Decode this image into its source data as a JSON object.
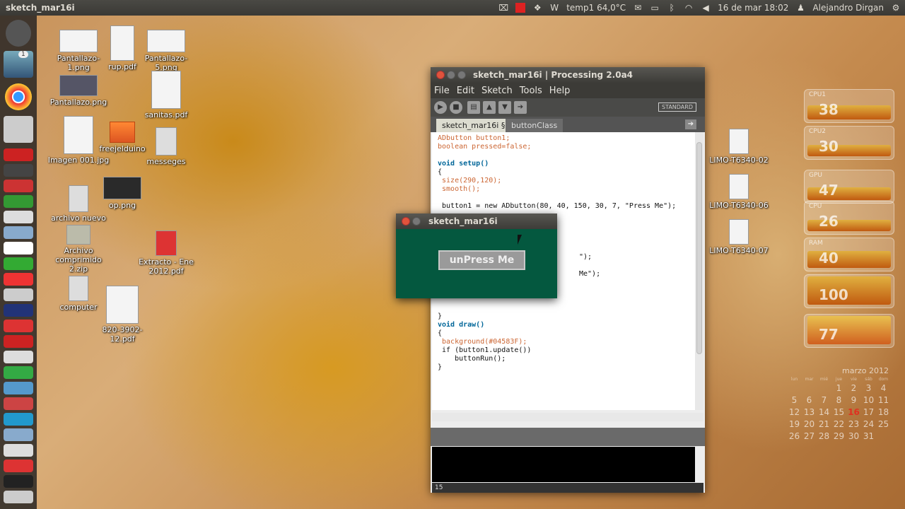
{
  "panel": {
    "title": "sketch_mar16i",
    "temp": "temp1 64,0°C",
    "datetime": "16 de mar 18:02",
    "user": "Alejandro Dirgan"
  },
  "launcher": {
    "badge": "1"
  },
  "desktop_icons": [
    {
      "label": "Pantallazo-1.png"
    },
    {
      "label": "rup.pdf"
    },
    {
      "label": "Pantallazo-5.png"
    },
    {
      "label": "Pantallazo.png"
    },
    {
      "label": "sanitas.pdf"
    },
    {
      "label": "Imagen 001.jpg"
    },
    {
      "label": "freejelduino"
    },
    {
      "label": "messeges"
    },
    {
      "label": "archivo nuevo"
    },
    {
      "label": "op.png"
    },
    {
      "label": "Archivo comprimido 2.zip"
    },
    {
      "label": "Extracto - Ene 2012.pdf"
    },
    {
      "label": "computer"
    },
    {
      "label": "820-3902-12.pdf"
    },
    {
      "label": "LIMO-T6340-02"
    },
    {
      "label": "LIMO-T6340-06"
    },
    {
      "label": "LIMO-T6340-07"
    }
  ],
  "processing": {
    "title": "sketch_mar16i | Processing 2.0a4",
    "menu": [
      "File",
      "Edit",
      "Sketch",
      "Tools",
      "Help"
    ],
    "mode": "STANDARD",
    "tabs": [
      "sketch_mar16i §",
      "buttonClass"
    ],
    "code": {
      "l1": "ADbutton button1;",
      "l2": "boolean pressed=false;",
      "l3": "void setup()",
      "l4": "{",
      "l5": " size(290,120);",
      "l6": " smooth();",
      "l7": " button1 = new ADbutton(80, 40, 150, 30, 7, \"Press Me\");",
      "l8": "\");",
      "l9": "Me\");",
      "l10": "}",
      "l11": "void draw()",
      "l12": "{",
      "l13": " background(#04583F);",
      "l14": " if (button1.update())",
      "l15": "    buttonRun();",
      "l16": "}"
    },
    "line_number": "15"
  },
  "sketch_window": {
    "title": "sketch_mar16i",
    "button_label": "unPress Me",
    "background": "#04583F"
  },
  "widgets": [
    {
      "label": "CPU1",
      "value": "38"
    },
    {
      "label": "CPU2",
      "value": "30"
    },
    {
      "label": "GPU",
      "value": "47"
    },
    {
      "label": "CPU",
      "value": "26"
    },
    {
      "label": "RAM",
      "value": "40"
    },
    {
      "label": "",
      "value": "100"
    },
    {
      "label": "",
      "value": "77"
    }
  ],
  "calendar": {
    "title": "marzo 2012",
    "head": [
      "lun",
      "mar",
      "mié",
      "jue",
      "vie",
      "sáb",
      "dom"
    ],
    "rows": [
      [
        "",
        "",
        "",
        "1",
        "2",
        "3",
        "4"
      ],
      [
        "5",
        "6",
        "7",
        "8",
        "9",
        "10",
        "11"
      ],
      [
        "12",
        "13",
        "14",
        "15",
        "16",
        "17",
        "18"
      ],
      [
        "19",
        "20",
        "21",
        "22",
        "23",
        "24",
        "25"
      ],
      [
        "26",
        "27",
        "28",
        "29",
        "30",
        "31",
        ""
      ]
    ],
    "today": "16"
  }
}
